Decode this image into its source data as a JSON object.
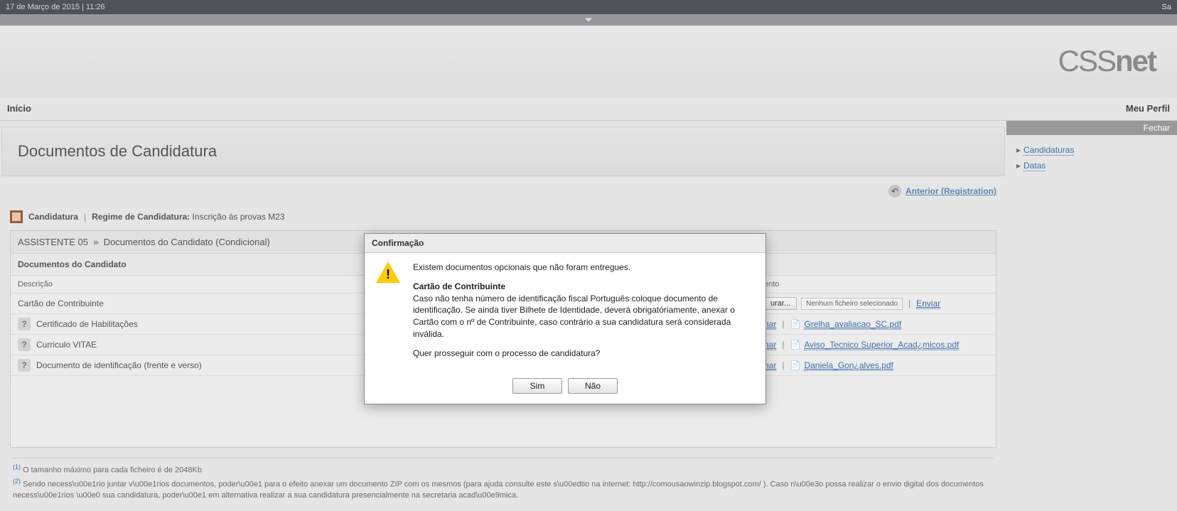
{
  "topbar": {
    "datetime": "17 de Março de 2015 | 11:26",
    "right": "Sa"
  },
  "logo": {
    "part1": "CSS",
    "part2": "net"
  },
  "nav": {
    "home": "Início",
    "profile": "Meu Perfil"
  },
  "sidebar": {
    "close_label": "Fechar",
    "items": [
      {
        "label": "Candidaturas"
      },
      {
        "label": "Datas"
      }
    ]
  },
  "page_title": "Documentos de Candidatura",
  "anterior": {
    "label": "Anterior (Registration)"
  },
  "breadcrumb": {
    "root": "Candidatura",
    "regime_label": "Regime de Candidatura:",
    "regime_value": "Inscrição às provas M23"
  },
  "panel": {
    "head_prefix": "ASSISTENTE 05",
    "head_sep": "»",
    "head_suffix": "Documentos do Candidato (Condicional)",
    "subhead": "Documentos do Candidato",
    "columns": {
      "desc": "Descrição",
      "doc": "ento"
    },
    "rows": [
      {
        "desc": "Cartão de Contribuinte",
        "help": false,
        "browse": "urar...",
        "file_none": "Nenhum ficheiro selecionado",
        "send": "Enviar",
        "hide_browse": false,
        "attached": null
      },
      {
        "desc": "Certificado de Habilitações",
        "help": true,
        "browse": "",
        "file_none": "",
        "send": "",
        "hide_browse": true,
        "elim": "nar",
        "attached": "Grelha_avaliacao_SC.pdf"
      },
      {
        "desc": "Curriculo VITAE",
        "help": true,
        "browse": "",
        "file_none": "",
        "send": "",
        "hide_browse": true,
        "elim": "nar",
        "attached": "Aviso_Tecnico Superior_Acad¿micos.pdf"
      },
      {
        "desc": "Documento de identificação (frente e verso)",
        "help": true,
        "browse": "",
        "file_none": "",
        "send": "",
        "hide_browse": true,
        "elim": "nar",
        "attached": "Daniela_Gon¿alves.pdf"
      }
    ]
  },
  "footnotes": {
    "n1": "O tamanho máximo para cada ficheiro é de 2048Kb",
    "n2": "Sendo necess\\u00e1rio juntar v\\u00e1rios documentos, poder\\u00e1 para o efeito anexar um documento ZIP com os mesmos (para ajuda consulte este s\\u00edtio na internet: http://comousaowinzip.blogspot.com/ ). Caso n\\u00e3o possa realizar o envio digital dos documentos necess\\u00e1rios \\u00e0 sua candidatura, poder\\u00e1 em alternativa realizar a sua candidatura presencialmente na secretaria acad\\u00e9mica."
  },
  "modal": {
    "title": "Confirmação",
    "p1": "Existem documentos opcionais que não foram entregues.",
    "h": "Cartão de Contribuinte",
    "p2": "Caso não tenha número de identificação fiscal Português coloque documento de identificação. Se ainda tiver Bilhete de Identidade, deverá obrigatóriamente, anexar o Cartão com o nº de Contribuinte, caso contrário a sua candidatura será considerada inválida.",
    "p3": "Quer prosseguir com o processo de candidatura?",
    "yes": "Sim",
    "no": "Não"
  }
}
